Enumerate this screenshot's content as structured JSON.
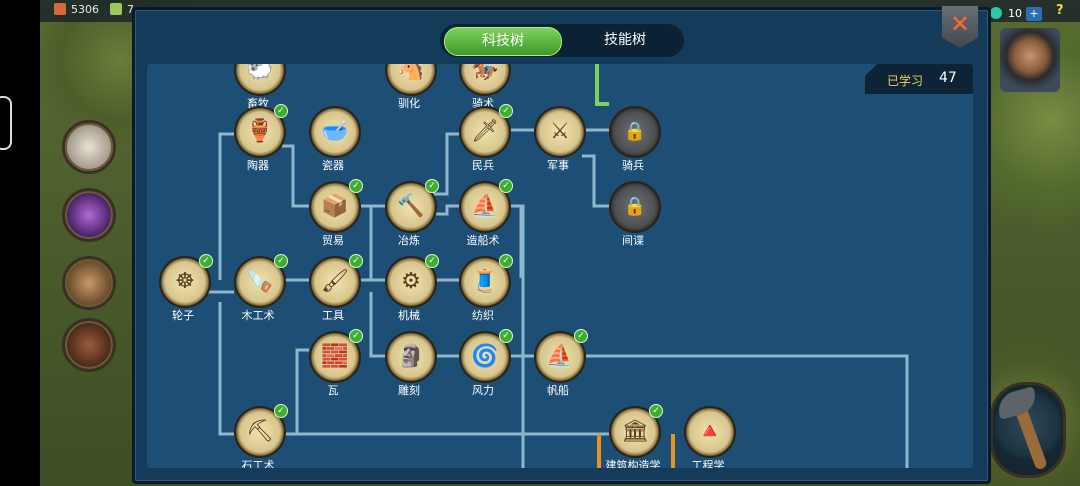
{
  "top_bar": {
    "wood": "5306",
    "food": "7",
    "gems": "10",
    "plus": "+",
    "help": "?"
  },
  "tabs": {
    "active": "科技树",
    "inactive": "技能树"
  },
  "close": {
    "glyph": "✕"
  },
  "learned": {
    "label": "已学习",
    "count": "47"
  },
  "nodes": [
    {
      "name": "畜牧",
      "glyph": "🐑",
      "locked": false,
      "checked": false
    },
    {
      "name": "驯化",
      "glyph": "🐴",
      "locked": false,
      "checked": false
    },
    {
      "name": "骑术",
      "glyph": "🏇",
      "locked": false,
      "checked": false
    },
    {
      "name": "陶器",
      "glyph": "🏺",
      "locked": false,
      "checked": true
    },
    {
      "name": "瓷器",
      "glyph": "🥣",
      "locked": false,
      "checked": false
    },
    {
      "name": "民兵",
      "glyph": "🗡",
      "locked": false,
      "checked": true
    },
    {
      "name": "军事",
      "glyph": "⚔",
      "locked": false,
      "checked": false
    },
    {
      "name": "骑兵",
      "glyph": "🔒",
      "locked": true,
      "checked": false
    },
    {
      "name": "贸易",
      "glyph": "📦",
      "locked": false,
      "checked": true
    },
    {
      "name": "冶炼",
      "glyph": "🔨",
      "locked": false,
      "checked": true
    },
    {
      "name": "造船术",
      "glyph": "⛵",
      "locked": false,
      "checked": true
    },
    {
      "name": "间谍",
      "glyph": "🔒",
      "locked": true,
      "checked": false
    },
    {
      "name": "轮子",
      "glyph": "☸",
      "locked": false,
      "checked": true
    },
    {
      "name": "木工术",
      "glyph": "🪚",
      "locked": false,
      "checked": true
    },
    {
      "name": "工具",
      "glyph": "🖌",
      "locked": false,
      "checked": true
    },
    {
      "name": "机械",
      "glyph": "⚙",
      "locked": false,
      "checked": true
    },
    {
      "name": "纺织",
      "glyph": "🧵",
      "locked": false,
      "checked": true
    },
    {
      "name": "瓦",
      "glyph": "🧱",
      "locked": false,
      "checked": true
    },
    {
      "name": "雕刻",
      "glyph": "🗿",
      "locked": false,
      "checked": false
    },
    {
      "name": "风力",
      "glyph": "🌀",
      "locked": false,
      "checked": true
    },
    {
      "name": "帆船",
      "glyph": "⛵",
      "locked": false,
      "checked": true
    },
    {
      "name": "石工术",
      "glyph": "⛏",
      "locked": false,
      "checked": true
    },
    {
      "name": "建筑构造学",
      "glyph": "🏛",
      "locked": false,
      "checked": true
    },
    {
      "name": "工程学",
      "glyph": "🔺",
      "locked": false,
      "checked": false
    }
  ],
  "colors": {
    "line": "#8fb8cf",
    "orange": "#e8921f",
    "green": "#7fd15e",
    "panel": "#143b5a",
    "tree": "#1c4e76"
  }
}
